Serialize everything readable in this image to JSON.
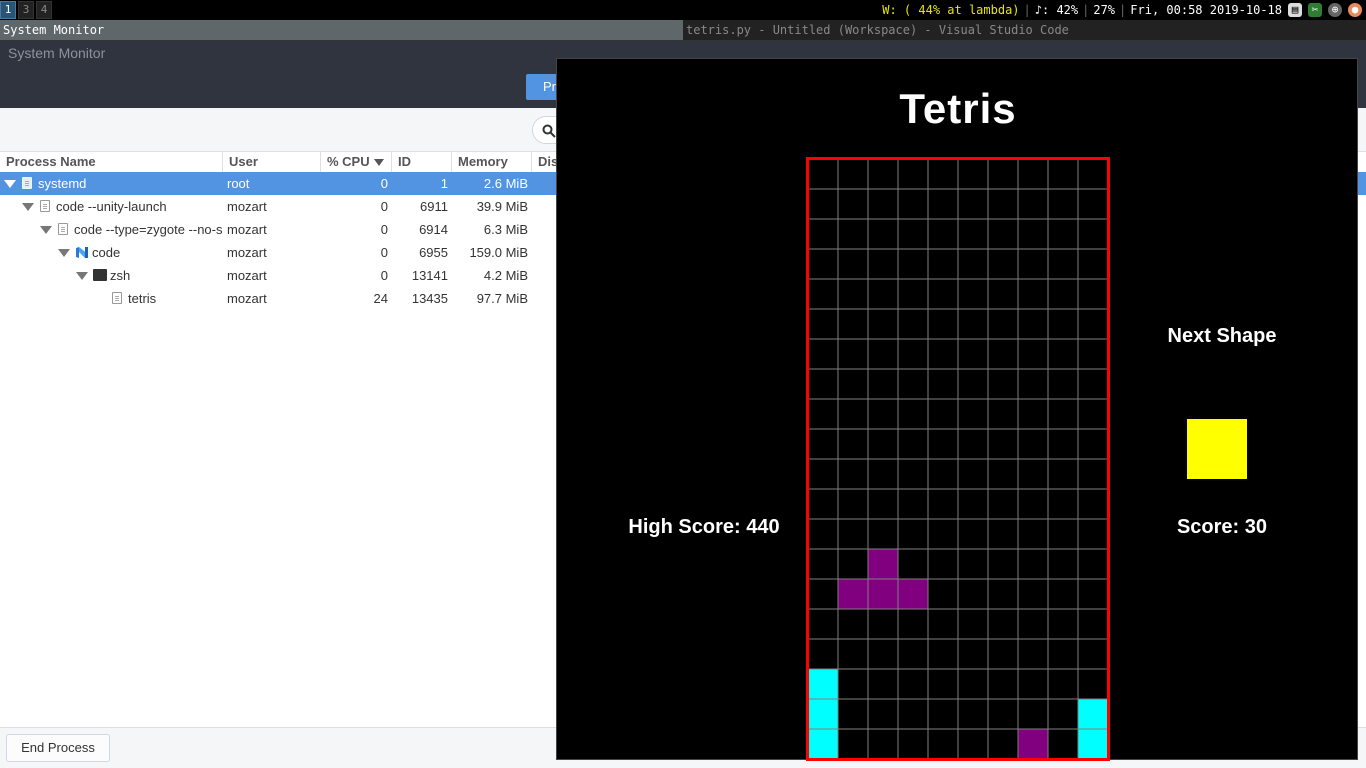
{
  "topbar": {
    "workspaces": [
      "1",
      "3",
      "4"
    ],
    "active_workspace": "1",
    "wifi": "W: ( 44% at lambda)",
    "volume": "♪: 42%",
    "battery": "27%",
    "datetime": "Fri, 00:58 2019-10-18"
  },
  "window_tabs": {
    "left": "System Monitor",
    "right": "tetris.py - Untitled (Workspace) - Visual Studio Code"
  },
  "sysmon": {
    "title": "System Monitor",
    "tab_processes": "Processes",
    "columns": {
      "name": "Process Name",
      "user": "User",
      "cpu": "% CPU",
      "id": "ID",
      "memory": "Memory",
      "disk": "Disk"
    },
    "rows": [
      {
        "name": "systemd",
        "user": "root",
        "cpu": "0",
        "id": "1",
        "memory": "2.6 MiB"
      },
      {
        "name": "code --unity-launch",
        "user": "mozart",
        "cpu": "0",
        "id": "6911",
        "memory": "39.9 MiB"
      },
      {
        "name": "code --type=zygote --no-sandbox",
        "user": "mozart",
        "cpu": "0",
        "id": "6914",
        "memory": "6.3 MiB"
      },
      {
        "name": "code",
        "user": "mozart",
        "cpu": "0",
        "id": "6955",
        "memory": "159.0 MiB"
      },
      {
        "name": "zsh",
        "user": "mozart",
        "cpu": "0",
        "id": "13141",
        "memory": "4.2 MiB"
      },
      {
        "name": "tetris",
        "user": "mozart",
        "cpu": "24",
        "id": "13435",
        "memory": "97.7 MiB"
      }
    ],
    "end_process": "End Process"
  },
  "tetris": {
    "title": "Tetris",
    "next_shape_label": "Next Shape",
    "score_label": "Score: 30",
    "high_score_label": "High Score: 440",
    "next_shape_color": "#ffff00",
    "colors": {
      "C": "#00ffff",
      "P": "#800080",
      "Y": "#ffff00"
    },
    "grid": [
      "..........",
      "..........",
      "..........",
      "..........",
      "..........",
      "..........",
      "..........",
      "..........",
      "..........",
      "..........",
      "..........",
      "..........",
      "..........",
      "..P.......",
      ".PPP......",
      "..........",
      "..........",
      "C.........",
      "C........C",
      "C......P.C"
    ]
  }
}
